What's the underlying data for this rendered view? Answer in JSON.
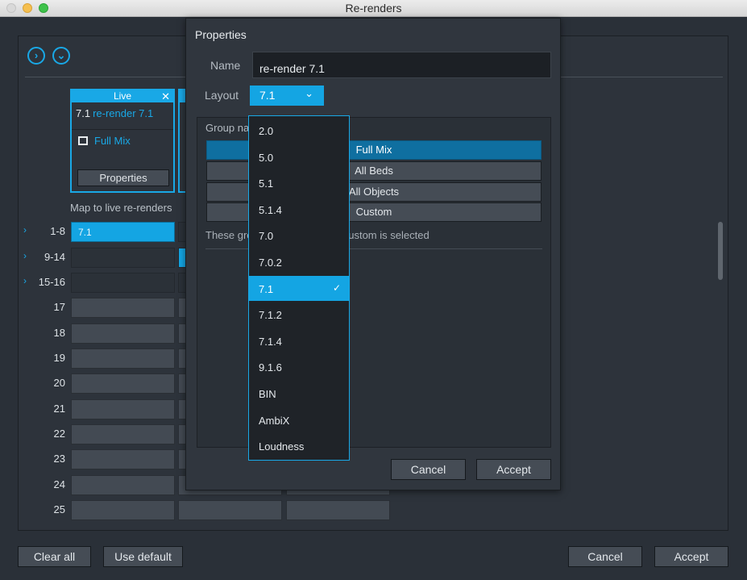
{
  "window": {
    "title": "Re-renders"
  },
  "live": {
    "header": "Live",
    "close_icon": "✕",
    "layout": "7.1",
    "name": "re-render 7.1",
    "group": "Full Mix",
    "properties_label": "Properties"
  },
  "map_label": "Map to live re-renders",
  "rows": [
    {
      "label": "1-8",
      "expand": "›",
      "value": "7.1"
    },
    {
      "label": "9-14",
      "expand": "›"
    },
    {
      "label": "15-16",
      "expand": "›"
    },
    {
      "label": "17"
    },
    {
      "label": "18"
    },
    {
      "label": "19"
    },
    {
      "label": "20"
    },
    {
      "label": "21"
    },
    {
      "label": "22"
    },
    {
      "label": "23"
    },
    {
      "label": "24"
    },
    {
      "label": "25"
    }
  ],
  "footer": {
    "clear_all": "Clear all",
    "use_default": "Use default",
    "cancel": "Cancel",
    "accept": "Accept"
  },
  "properties": {
    "title": "Properties",
    "name_label": "Name",
    "name_value": "re-render 7.1",
    "layout_label": "Layout",
    "layout_value": "7.1",
    "group_label": "Group na",
    "groups": [
      "Full Mix",
      "All Beds",
      "All Objects",
      "Custom"
    ],
    "active_group": "Full Mix",
    "hint": "These gro",
    "hint_tail": "hen Custom is selected",
    "cancel": "Cancel",
    "accept": "Accept"
  },
  "layout_options": [
    "2.0",
    "5.0",
    "5.1",
    "5.1.4",
    "7.0",
    "7.0.2",
    "7.1",
    "7.1.2",
    "7.1.4",
    "9.1.6",
    "BIN",
    "AmbiX",
    "Loudness"
  ],
  "layout_selected": "7.1",
  "icons": {
    "next": "›",
    "expand_all": "⌄",
    "chevron": "⌄",
    "check": "✓"
  },
  "colors": {
    "accent": "#14a5e3",
    "background": "#2a3038",
    "panel": "#2d333b"
  }
}
